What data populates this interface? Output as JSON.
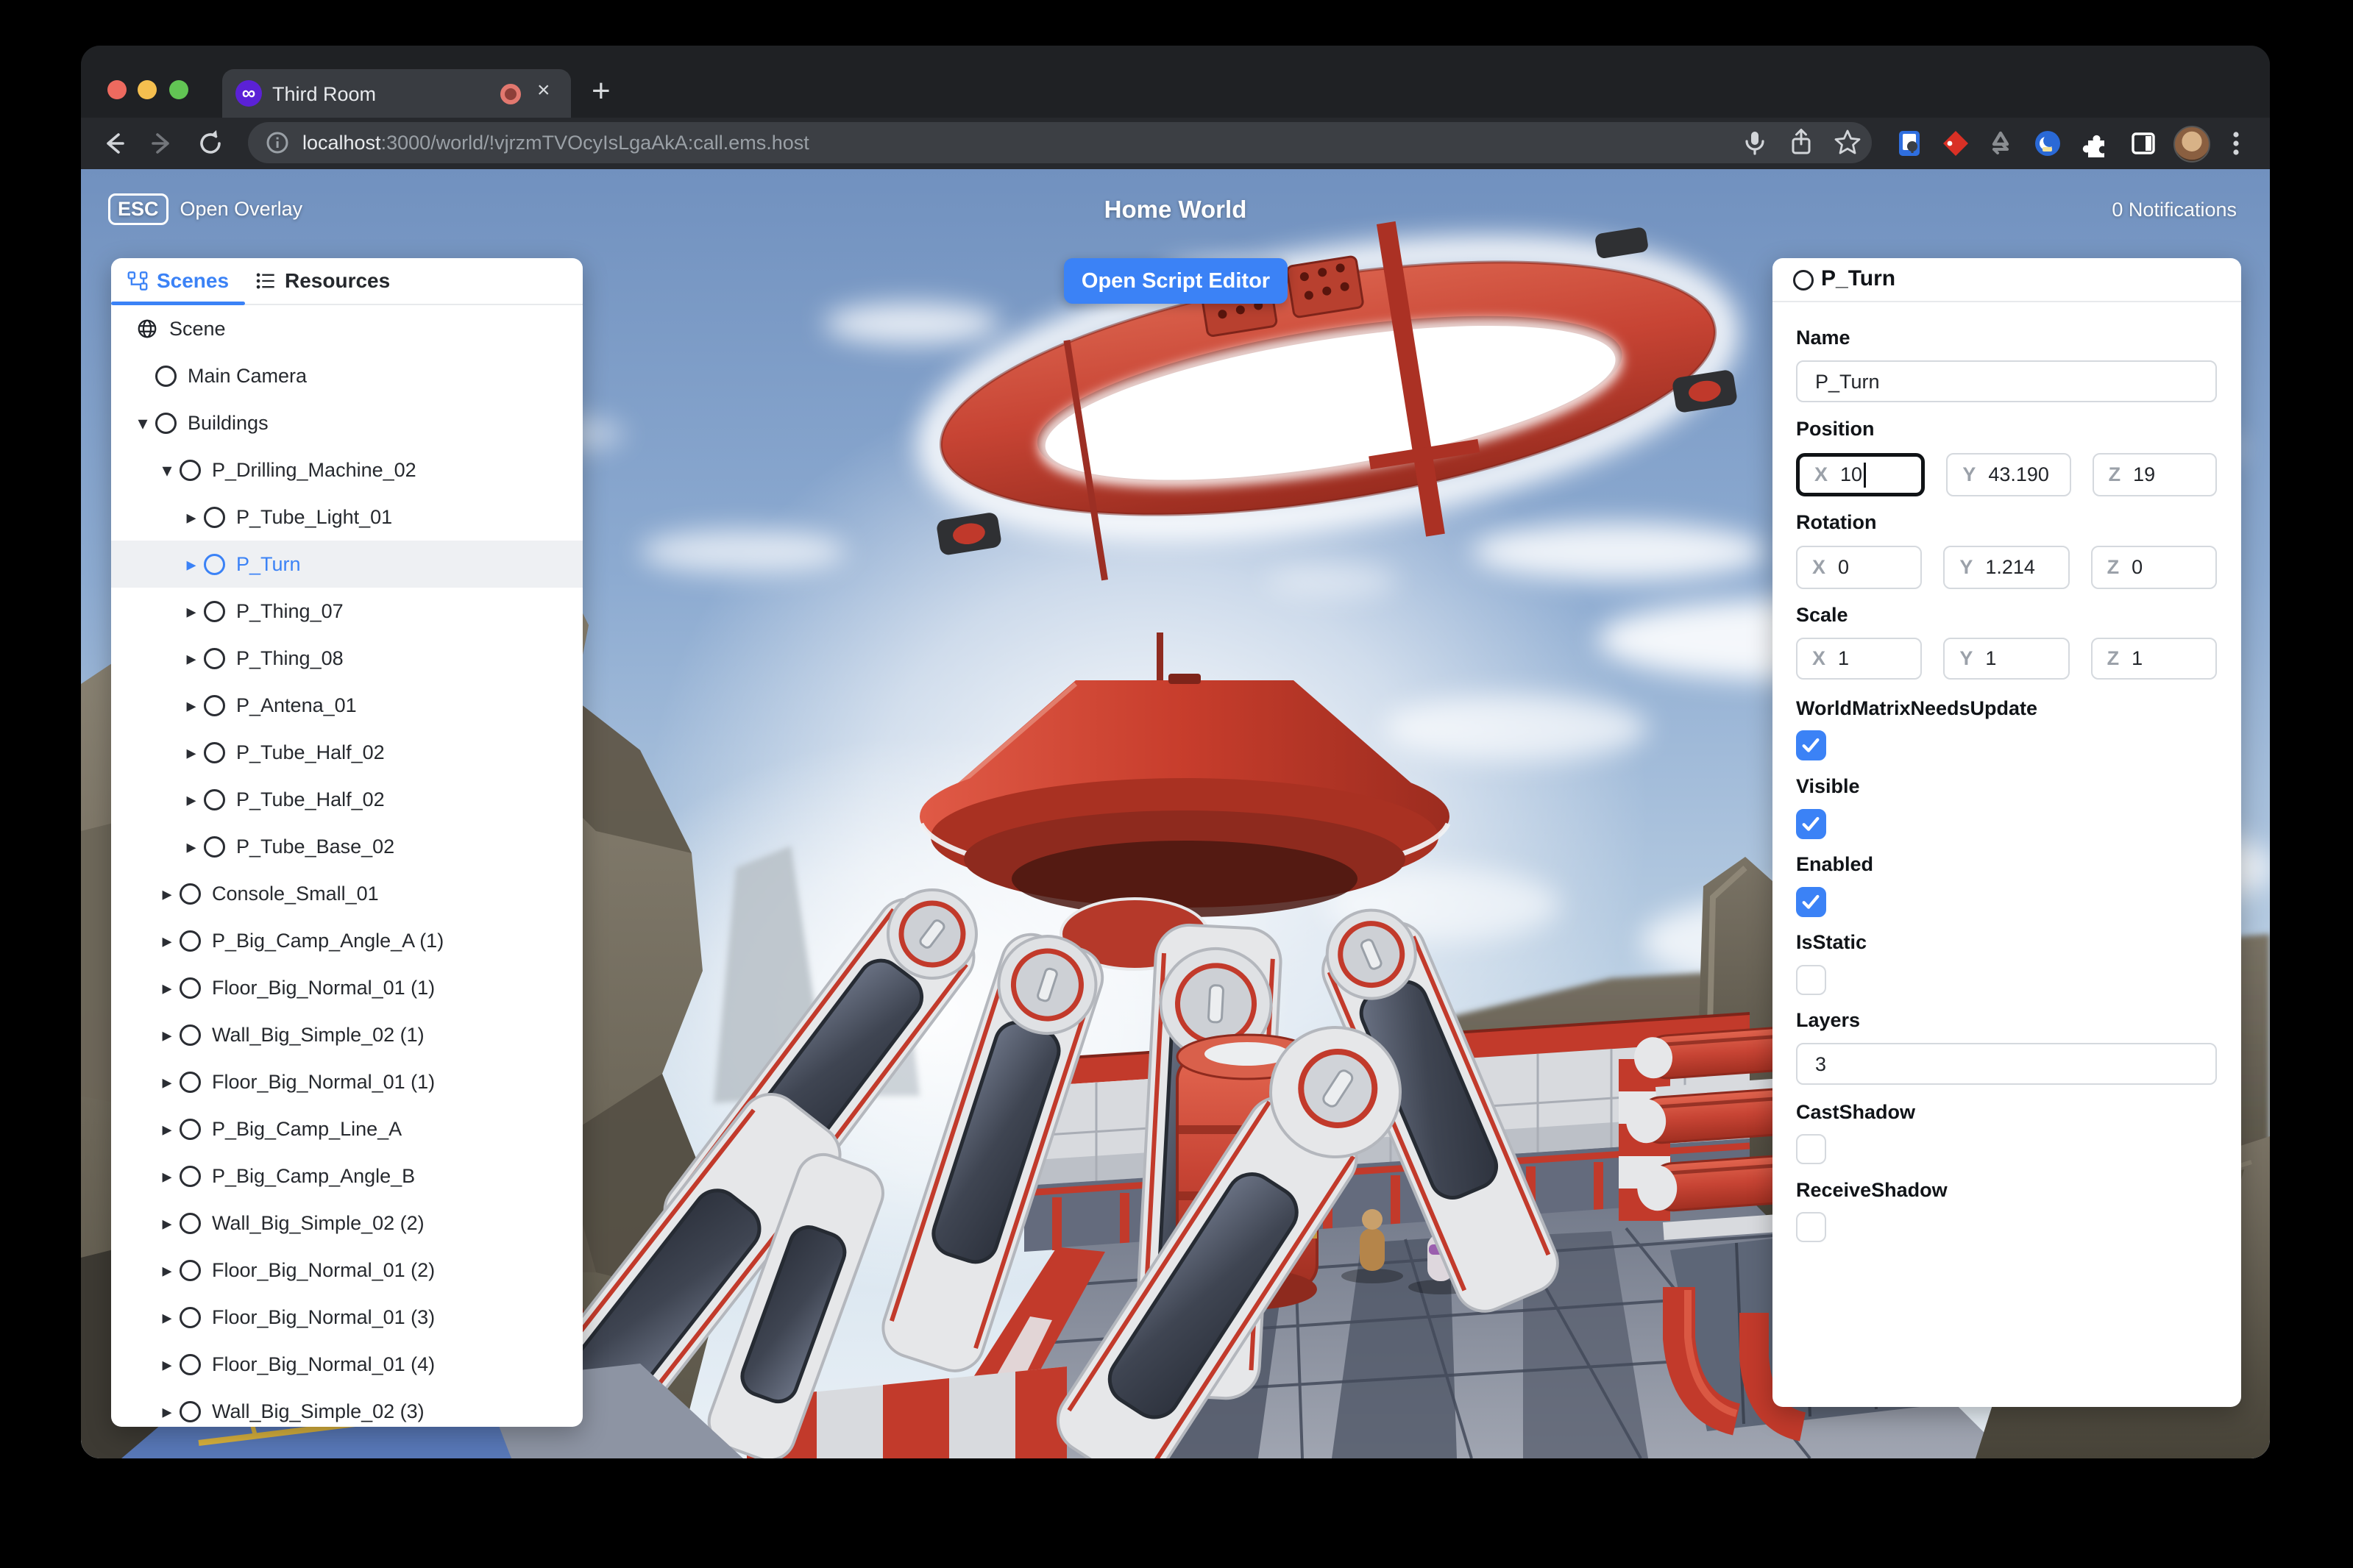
{
  "browser": {
    "tab_title": "Third Room",
    "url_host": "localhost",
    "url_rest": ":3000/world/!vjrzmTVOcyIsLgaAkA:call.ems.host",
    "new_tab_glyph": "+",
    "close_tab_glyph": "×",
    "favicon_glyph": "∞"
  },
  "hud": {
    "esc_key": "ESC",
    "open_overlay_label": "Open Overlay",
    "world_title": "Home World",
    "notifications": "0 Notifications",
    "open_script_editor": "Open Script Editor"
  },
  "left_panel": {
    "tabs": [
      {
        "label": "Scenes",
        "active": true
      },
      {
        "label": "Resources",
        "active": false
      }
    ],
    "tree": [
      {
        "label": "Scene",
        "level": 0,
        "icon": "globe",
        "arrow": "none",
        "selected": false
      },
      {
        "label": "Main Camera",
        "level": 1,
        "icon": "circle",
        "arrow": "none",
        "selected": false
      },
      {
        "label": "Buildings",
        "level": 1,
        "icon": "circle",
        "arrow": "down",
        "selected": false
      },
      {
        "label": "P_Drilling_Machine_02",
        "level": 2,
        "icon": "circle",
        "arrow": "down",
        "selected": false
      },
      {
        "label": "P_Tube_Light_01",
        "level": 3,
        "icon": "circle",
        "arrow": "right",
        "selected": false
      },
      {
        "label": "P_Turn",
        "level": 3,
        "icon": "circle",
        "arrow": "right",
        "selected": true
      },
      {
        "label": "P_Thing_07",
        "level": 3,
        "icon": "circle",
        "arrow": "right",
        "selected": false
      },
      {
        "label": "P_Thing_08",
        "level": 3,
        "icon": "circle",
        "arrow": "right",
        "selected": false
      },
      {
        "label": "P_Antena_01",
        "level": 3,
        "icon": "circle",
        "arrow": "right",
        "selected": false
      },
      {
        "label": "P_Tube_Half_02",
        "level": 3,
        "icon": "circle",
        "arrow": "right",
        "selected": false
      },
      {
        "label": "P_Tube_Half_02",
        "level": 3,
        "icon": "circle",
        "arrow": "right",
        "selected": false
      },
      {
        "label": "P_Tube_Base_02",
        "level": 3,
        "icon": "circle",
        "arrow": "right",
        "selected": false
      },
      {
        "label": "Console_Small_01",
        "level": 2,
        "icon": "circle",
        "arrow": "right",
        "selected": false
      },
      {
        "label": "P_Big_Camp_Angle_A (1)",
        "level": 2,
        "icon": "circle",
        "arrow": "right",
        "selected": false
      },
      {
        "label": "Floor_Big_Normal_01 (1)",
        "level": 2,
        "icon": "circle",
        "arrow": "right",
        "selected": false
      },
      {
        "label": "Wall_Big_Simple_02 (1)",
        "level": 2,
        "icon": "circle",
        "arrow": "right",
        "selected": false
      },
      {
        "label": "Floor_Big_Normal_01 (1)",
        "level": 2,
        "icon": "circle",
        "arrow": "right",
        "selected": false
      },
      {
        "label": "P_Big_Camp_Line_A",
        "level": 2,
        "icon": "circle",
        "arrow": "right",
        "selected": false
      },
      {
        "label": "P_Big_Camp_Angle_B",
        "level": 2,
        "icon": "circle",
        "arrow": "right",
        "selected": false
      },
      {
        "label": "Wall_Big_Simple_02 (2)",
        "level": 2,
        "icon": "circle",
        "arrow": "right",
        "selected": false
      },
      {
        "label": "Floor_Big_Normal_01 (2)",
        "level": 2,
        "icon": "circle",
        "arrow": "right",
        "selected": false
      },
      {
        "label": "Floor_Big_Normal_01 (3)",
        "level": 2,
        "icon": "circle",
        "arrow": "right",
        "selected": false
      },
      {
        "label": "Floor_Big_Normal_01 (4)",
        "level": 2,
        "icon": "circle",
        "arrow": "right",
        "selected": false
      },
      {
        "label": "Wall_Big_Simple_02 (3)",
        "level": 2,
        "icon": "circle",
        "arrow": "right",
        "selected": false
      }
    ]
  },
  "inspector": {
    "title": "P_Turn",
    "axes": [
      "X",
      "Y",
      "Z"
    ],
    "name": {
      "label": "Name",
      "value": "P_Turn"
    },
    "position": {
      "label": "Position",
      "x": "10",
      "y": "43.190",
      "z": "19"
    },
    "rotation": {
      "label": "Rotation",
      "x": "0",
      "y": "1.214",
      "z": "0"
    },
    "scale": {
      "label": "Scale",
      "x": "1",
      "y": "1",
      "z": "1"
    },
    "world_matrix_needs_update": {
      "label": "WorldMatrixNeedsUpdate",
      "checked": true
    },
    "visible": {
      "label": "Visible",
      "checked": true
    },
    "enabled": {
      "label": "Enabled",
      "checked": true
    },
    "is_static": {
      "label": "IsStatic",
      "checked": false
    },
    "layers": {
      "label": "Layers",
      "value": "3"
    },
    "cast_shadow": {
      "label": "CastShadow",
      "checked": false
    },
    "receive_shadow": {
      "label": "ReceiveShadow",
      "checked": false
    }
  },
  "colors": {
    "accent_blue": "#3b82f6",
    "machine_red": "#c23a2b",
    "tab_favicon_purple": "#5b21d6",
    "checkbox_checked": "#3b82f6"
  }
}
